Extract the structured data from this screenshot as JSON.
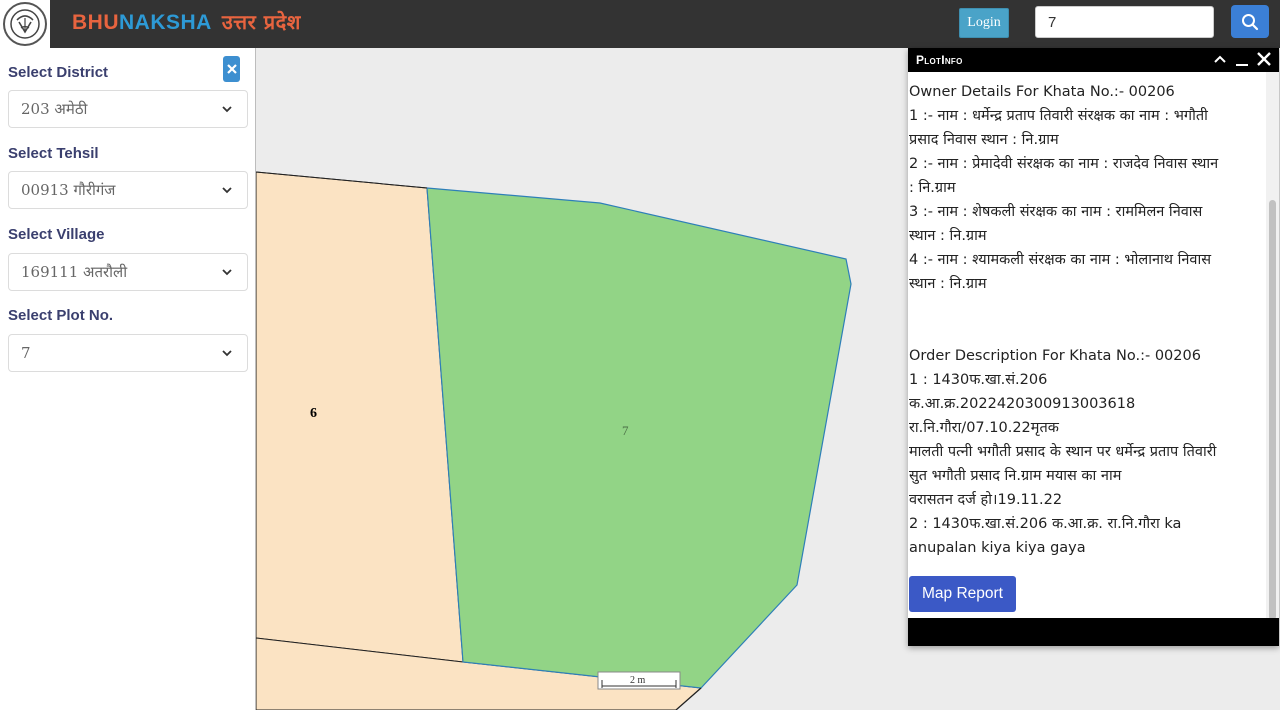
{
  "header": {
    "brand_part1": "BHU",
    "brand_part2": "NAKSHA",
    "brand_state": "उत्तर प्रदेश",
    "login_label": "Login",
    "search_value": "7"
  },
  "sidebar": {
    "district_label": "Select District",
    "district_value": "203 अमेठी",
    "tehsil_label": "Select Tehsil",
    "tehsil_value": "00913 गौरीगंज",
    "village_label": "Select Village",
    "village_value": "169111 अतरौली",
    "plot_label": "Select Plot No.",
    "plot_value": "7"
  },
  "map": {
    "plots": [
      {
        "label": "6"
      },
      {
        "label": "7"
      }
    ],
    "scale_text": "2 m"
  },
  "plot_info": {
    "title": "PlotInfo",
    "owner_heading": "Owner Details For Khata No.:- 00206",
    "owner_lines": [
      "1 :- नाम : धर्मेन्द्र प्रताप तिवारी संरक्षक का नाम : भगौती",
      "प्रसाद निवास स्थान : नि.ग्राम",
      "2 :- नाम : प्रेमादेवी संरक्षक का नाम : राजदेव निवास स्थान",
      ": नि.ग्राम",
      "3 :- नाम : शेषकली संरक्षक का नाम : राममिलन निवास",
      "स्थान : नि.ग्राम",
      "4 :- नाम : श्यामकली संरक्षक का नाम : भोलानाथ निवास",
      "स्थान : नि.ग्राम"
    ],
    "order_heading": "Order Description For Khata No.:- 00206",
    "order_lines": [
      "1 : 1430फ.खा.सं.206",
      "क.आ.क्र.202242030091300361​8",
      "रा.नि.गौरा/07.10.22मृतक",
      "मालती पत्नी भगौती प्रसाद के स्थान पर धर्मेन्द्र प्रताप तिवारी",
      "सुत भगौती प्रसाद नि.ग्राम मयास का नाम",
      "वरासतन दर्ज हो।19.11.22",
      "2 : 1430फ.खा.सं.206 क.आ.क्र. रा.नि.गौरा ka",
      "anupalan kiya kiya gaya"
    ],
    "map_report_label": "Map Report"
  },
  "colors": {
    "header_bg": "#333333",
    "plot_selected": "#92d486",
    "plot_other": "#fbe3c3",
    "accent_blue": "#3b59c6"
  },
  "icons": [
    "up-emblem-icon",
    "search-icon",
    "close-icon",
    "chevron-down-icon",
    "chevron-up-icon",
    "minimize-icon"
  ]
}
